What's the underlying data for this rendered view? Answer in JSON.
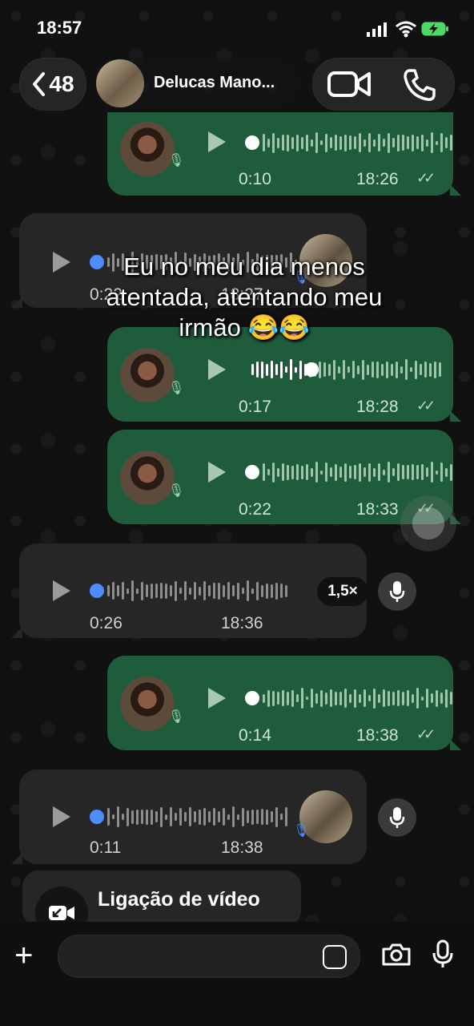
{
  "status_bar": {
    "time": "18:57"
  },
  "header": {
    "back_count": "48",
    "contact_name": "Delucas Mano..."
  },
  "caption": "Eu no meu dia menos atentada, atentando meu irmão 😂😂",
  "messages": [
    {
      "direction": "out",
      "duration": "0:10",
      "time": "18:26"
    },
    {
      "direction": "in",
      "duration": "0:22",
      "time": "18:27"
    },
    {
      "direction": "out",
      "duration": "0:17",
      "time": "18:28"
    },
    {
      "direction": "out",
      "duration": "0:22",
      "time": "18:33"
    },
    {
      "direction": "in",
      "duration": "0:26",
      "time": "18:36",
      "speed": "1,5×"
    },
    {
      "direction": "out",
      "duration": "0:14",
      "time": "18:38"
    },
    {
      "direction": "in",
      "duration": "0:11",
      "time": "18:38"
    }
  ],
  "call_card": {
    "title": "Ligação de vídeo"
  },
  "colors": {
    "outgoing_bubble": "#1f5c3b",
    "incoming_bubble": "#262626",
    "blue_dot": "#4f8cff"
  }
}
